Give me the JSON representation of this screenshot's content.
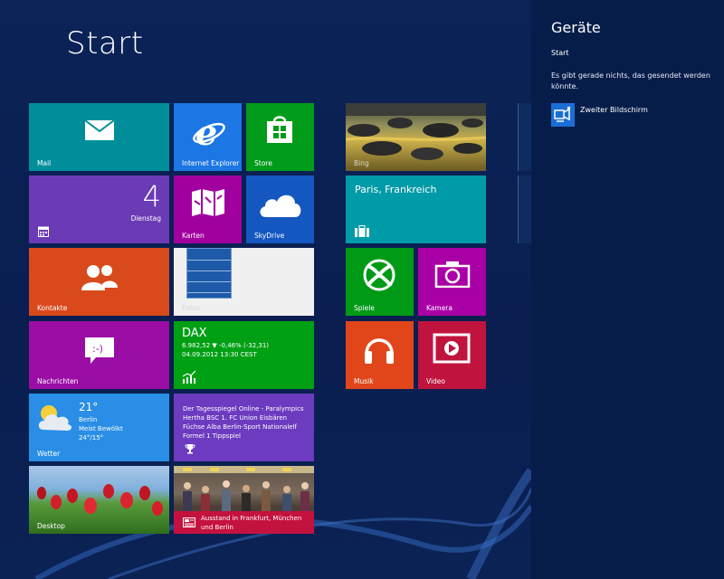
{
  "start": {
    "title": "Start"
  },
  "tiles": {
    "mail": {
      "label": "Mail",
      "color": "#008e9b"
    },
    "ie": {
      "label": "Internet Explorer",
      "color": "#1c76e4"
    },
    "store": {
      "label": "Store",
      "color": "#009c1a"
    },
    "calendar": {
      "day": "4",
      "weekday": "Dienstag",
      "color": "#6a3bb5"
    },
    "maps": {
      "label": "Karten",
      "color": "#a1009f"
    },
    "skydrive": {
      "label": "SkyDrive",
      "color": "#1457c0"
    },
    "contacts": {
      "label": "Kontakte",
      "color": "#d84a1b"
    },
    "photos": {
      "label": "Fotos",
      "color": "#f0f0f0"
    },
    "messages": {
      "label": "Nachrichten",
      "color": "#9a0ea5"
    },
    "finance": {
      "title": "DAX",
      "line1": "6.982,52 ▼ -0,46% (-32,31)",
      "line2": "04.09.2012 13:30 CEST",
      "color": "#00a014"
    },
    "weather": {
      "temp": "21°",
      "city": "Berlin",
      "cond": "Meist Bewölkt",
      "range": "24°/15°",
      "label": "Wetter",
      "color": "#2a8ee6"
    },
    "sport": {
      "text": "Der Tagesspiegel Online - Paralympics Hertha BSC 1. FC Union Eisbären Füchse Alba Berlin-Sport Nationalelf Formel 1 Tippspiel",
      "color": "#6c3bc0"
    },
    "desktop": {
      "label": "Desktop"
    },
    "news": {
      "headline": "Ausstand in Frankfurt, München und Berlin",
      "color": "#c4123f"
    },
    "bing": {
      "label": "Bing"
    },
    "travel": {
      "title": "Paris, Frankreich",
      "color": "#009ba8"
    },
    "games": {
      "label": "Spiele",
      "color": "#009a17"
    },
    "camera": {
      "label": "Kamera",
      "color": "#a900a6"
    },
    "music": {
      "label": "Musik",
      "color": "#e0461a"
    },
    "video": {
      "label": "Video",
      "color": "#c0133e"
    }
  },
  "panel": {
    "title": "Geräte",
    "subtitle": "Start",
    "message": "Es gibt gerade nichts, das gesendet werden könnte.",
    "device": {
      "label": "Zweiter Bildschirm",
      "icon": "projector-icon"
    }
  }
}
